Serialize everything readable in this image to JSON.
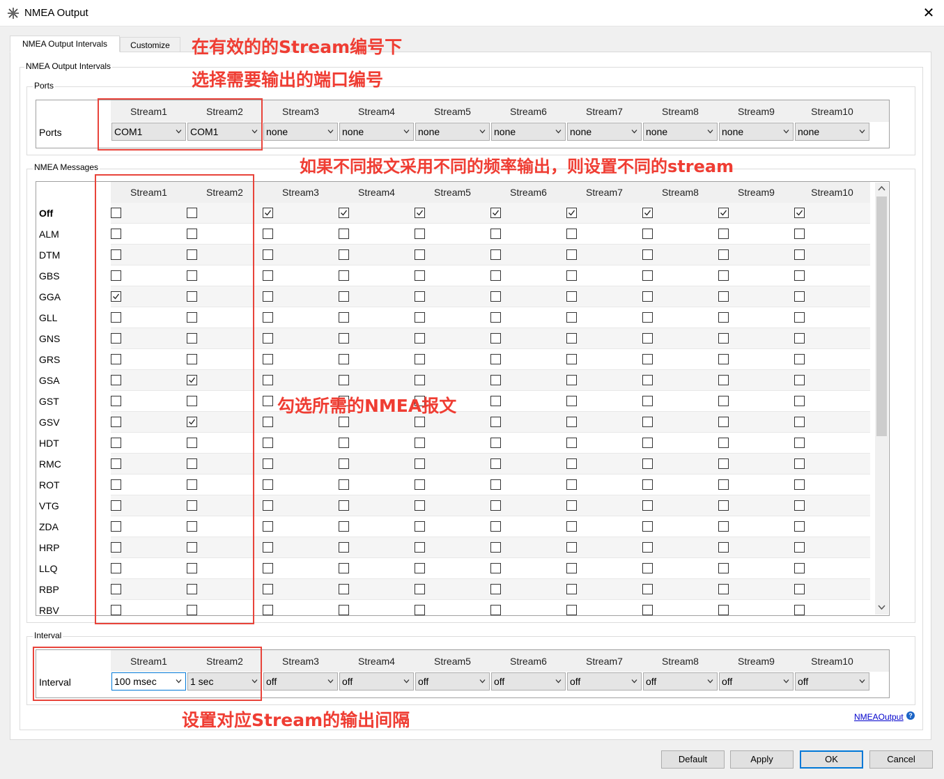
{
  "window": {
    "title": "NMEA Output",
    "close_label": "✕"
  },
  "tabs": [
    {
      "label": "NMEA Output Intervals"
    },
    {
      "label": "Customize"
    }
  ],
  "main_group_title": "NMEA Output Intervals",
  "streams": [
    "Stream1",
    "Stream2",
    "Stream3",
    "Stream4",
    "Stream5",
    "Stream6",
    "Stream7",
    "Stream8",
    "Stream9",
    "Stream10"
  ],
  "ports": {
    "group_title": "Ports",
    "row_label": "Ports",
    "values": [
      "COM1",
      "COM1",
      "none",
      "none",
      "none",
      "none",
      "none",
      "none",
      "none",
      "none"
    ]
  },
  "messages": {
    "group_title": "NMEA Messages",
    "rows": [
      {
        "label": "Off",
        "checked": [
          0,
          0,
          1,
          1,
          1,
          1,
          1,
          1,
          1,
          1
        ]
      },
      {
        "label": "ALM",
        "checked": [
          0,
          0,
          0,
          0,
          0,
          0,
          0,
          0,
          0,
          0
        ]
      },
      {
        "label": "DTM",
        "checked": [
          0,
          0,
          0,
          0,
          0,
          0,
          0,
          0,
          0,
          0
        ]
      },
      {
        "label": "GBS",
        "checked": [
          0,
          0,
          0,
          0,
          0,
          0,
          0,
          0,
          0,
          0
        ]
      },
      {
        "label": "GGA",
        "checked": [
          1,
          0,
          0,
          0,
          0,
          0,
          0,
          0,
          0,
          0
        ]
      },
      {
        "label": "GLL",
        "checked": [
          0,
          0,
          0,
          0,
          0,
          0,
          0,
          0,
          0,
          0
        ]
      },
      {
        "label": "GNS",
        "checked": [
          0,
          0,
          0,
          0,
          0,
          0,
          0,
          0,
          0,
          0
        ]
      },
      {
        "label": "GRS",
        "checked": [
          0,
          0,
          0,
          0,
          0,
          0,
          0,
          0,
          0,
          0
        ]
      },
      {
        "label": "GSA",
        "checked": [
          0,
          1,
          0,
          0,
          0,
          0,
          0,
          0,
          0,
          0
        ]
      },
      {
        "label": "GST",
        "checked": [
          0,
          0,
          0,
          0,
          0,
          0,
          0,
          0,
          0,
          0
        ]
      },
      {
        "label": "GSV",
        "checked": [
          0,
          1,
          0,
          0,
          0,
          0,
          0,
          0,
          0,
          0
        ]
      },
      {
        "label": "HDT",
        "checked": [
          0,
          0,
          0,
          0,
          0,
          0,
          0,
          0,
          0,
          0
        ]
      },
      {
        "label": "RMC",
        "checked": [
          0,
          0,
          0,
          0,
          0,
          0,
          0,
          0,
          0,
          0
        ]
      },
      {
        "label": "ROT",
        "checked": [
          0,
          0,
          0,
          0,
          0,
          0,
          0,
          0,
          0,
          0
        ]
      },
      {
        "label": "VTG",
        "checked": [
          0,
          0,
          0,
          0,
          0,
          0,
          0,
          0,
          0,
          0
        ]
      },
      {
        "label": "ZDA",
        "checked": [
          0,
          0,
          0,
          0,
          0,
          0,
          0,
          0,
          0,
          0
        ]
      },
      {
        "label": "HRP",
        "checked": [
          0,
          0,
          0,
          0,
          0,
          0,
          0,
          0,
          0,
          0
        ]
      },
      {
        "label": "LLQ",
        "checked": [
          0,
          0,
          0,
          0,
          0,
          0,
          0,
          0,
          0,
          0
        ]
      },
      {
        "label": "RBP",
        "checked": [
          0,
          0,
          0,
          0,
          0,
          0,
          0,
          0,
          0,
          0
        ]
      },
      {
        "label": "RBV",
        "checked": [
          0,
          0,
          0,
          0,
          0,
          0,
          0,
          0,
          0,
          0
        ]
      }
    ]
  },
  "interval": {
    "group_title": "Interval",
    "row_label": "Interval",
    "values": [
      "100 msec",
      "1 sec",
      "off",
      "off",
      "off",
      "off",
      "off",
      "off",
      "off",
      "off"
    ]
  },
  "annotations": {
    "a1": "在有效的的Stream编号下",
    "a2": "选择需要输出的端口编号",
    "a3": "如果不同报文采用不同的频率输出，则设置不同的stream",
    "a4": "勾选所需的NMEA报文",
    "a5": "设置对应Stream的输出间隔"
  },
  "help_link": "NMEAOutput",
  "buttons": {
    "default": "Default",
    "apply": "Apply",
    "ok": "OK",
    "cancel": "Cancel"
  }
}
